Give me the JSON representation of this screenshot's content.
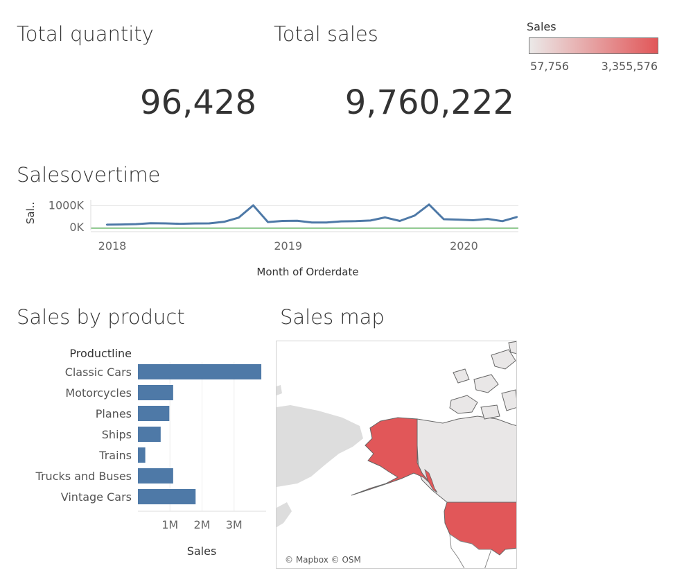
{
  "kpis": {
    "quantity_title": "Total quantity",
    "quantity_value": "96,428",
    "sales_title": "Total sales",
    "sales_value": "9,760,222"
  },
  "legend": {
    "title": "Sales",
    "min_label": "57,756",
    "max_label": "3,355,576",
    "color_min": "#ebe9e8",
    "color_max": "#e15759"
  },
  "sections": {
    "line_title": "Salesovertime",
    "bar_title": "Sales by product",
    "map_title": "Sales map"
  },
  "map": {
    "attribution": "© Mapbox © OSM",
    "highlight_color": "#e15759",
    "base_land_color": "#e9e7e7",
    "other_land_color": "#dddddd"
  },
  "chart_data": [
    {
      "type": "line",
      "title": "Salesovertime",
      "xlabel": "Month of Orderdate",
      "ylabel": "Sal..",
      "x": [
        "2018-01",
        "2018-02",
        "2018-03",
        "2018-04",
        "2018-05",
        "2018-06",
        "2018-07",
        "2018-08",
        "2018-09",
        "2018-10",
        "2018-11",
        "2018-12",
        "2019-01",
        "2019-02",
        "2019-03",
        "2019-04",
        "2019-05",
        "2019-06",
        "2019-07",
        "2019-08",
        "2019-09",
        "2019-10",
        "2019-11",
        "2019-12",
        "2020-01",
        "2020-02",
        "2020-03",
        "2020-04",
        "2020-05"
      ],
      "x_ticks": [
        "2018",
        "2019",
        "2020"
      ],
      "y_ticks": [
        "1000K",
        "0K"
      ],
      "ylim": [
        0,
        1200000
      ],
      "series": [
        {
          "values": [
            130000,
            140000,
            155000,
            200000,
            190000,
            170000,
            185000,
            190000,
            260000,
            450000,
            1010000,
            250000,
            300000,
            310000,
            230000,
            230000,
            280000,
            290000,
            320000,
            460000,
            300000,
            540000,
            1050000,
            380000,
            360000,
            330000,
            390000,
            290000,
            480000
          ],
          "color": "#4e79a7"
        }
      ],
      "reference_line_color": "#2ca02c"
    },
    {
      "type": "bar",
      "orientation": "horizontal",
      "title": "Sales by product",
      "category_header": "Productline",
      "categories": [
        "Classic Cars",
        "Motorcycles",
        "Planes",
        "Ships",
        "Trains",
        "Trucks and Buses",
        "Vintage Cars"
      ],
      "values": [
        3850000,
        1100000,
        980000,
        710000,
        230000,
        1100000,
        1800000
      ],
      "xlabel": "Sales",
      "x_ticks": [
        {
          "value": 1000000,
          "label": "1M"
        },
        {
          "value": 2000000,
          "label": "2M"
        },
        {
          "value": 3000000,
          "label": "3M"
        }
      ],
      "xlim": [
        0,
        4000000
      ],
      "color": "#4e79a7"
    }
  ]
}
